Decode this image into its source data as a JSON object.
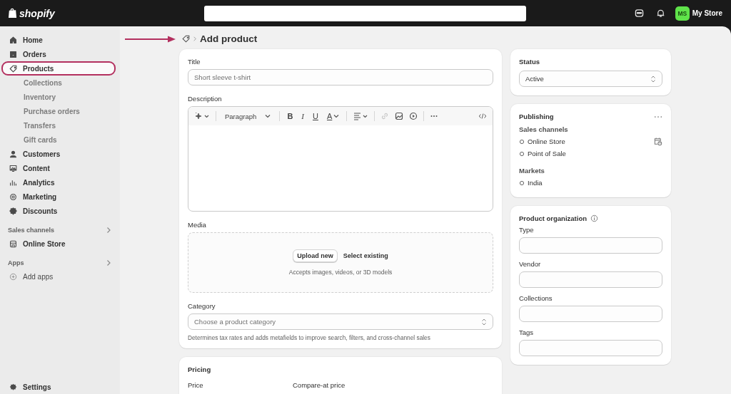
{
  "top_bar": {
    "logo": "shopify",
    "store": {
      "initials": "MS",
      "name": "My Store",
      "color": "#5fe34a"
    }
  },
  "annotations": {
    "arrow_to_title": true
  },
  "sidebar": {
    "items": [
      {
        "label": "Home",
        "selected": false,
        "outlined": false
      },
      {
        "label": "Orders",
        "selected": false,
        "outlined": false
      },
      {
        "label": "Products",
        "selected": true,
        "outlined": true,
        "children": [
          {
            "label": "Collections"
          },
          {
            "label": "Inventory"
          },
          {
            "label": "Purchase orders"
          },
          {
            "label": "Transfers"
          },
          {
            "label": "Gift cards"
          }
        ]
      },
      {
        "label": "Customers",
        "selected": false,
        "outlined": false
      },
      {
        "label": "Content",
        "selected": false,
        "outlined": false
      },
      {
        "label": "Analytics",
        "selected": false,
        "outlined": false
      },
      {
        "label": "Marketing",
        "selected": false,
        "outlined": false
      },
      {
        "label": "Discounts",
        "selected": false,
        "outlined": false
      }
    ],
    "sections": [
      {
        "title": "Sales channels",
        "items": [
          {
            "label": "Online Store",
            "kind": "store"
          }
        ]
      },
      {
        "title": "Apps",
        "items": [
          {
            "label": "Add apps",
            "kind": "add"
          }
        ]
      }
    ],
    "settings": "Settings"
  },
  "breadcrumb": {
    "title": "Add product"
  },
  "product_card": {
    "title_field": {
      "label": "Title",
      "placeholder": "Short sleeve t-shirt"
    },
    "description": {
      "label": "Description",
      "block_format": "Paragraph",
      "format_buttons": [
        {
          "label": "B",
          "kind": "bold"
        },
        {
          "label": "I",
          "kind": "italic"
        },
        {
          "label": "U",
          "kind": "underline"
        },
        {
          "label": "A",
          "kind": "color"
        }
      ],
      "link_disabled": true
    },
    "media": {
      "label": "Media",
      "upload_button": "Upload new",
      "select_link": "Select existing",
      "hint": "Accepts images, videos, or 3D models"
    },
    "category": {
      "label": "Category",
      "placeholder": "Choose a product category",
      "help": "Determines tax rates and adds metafields to improve search, filters, and cross-channel sales"
    }
  },
  "pricing": {
    "title": "Pricing",
    "labels": [
      "Price",
      "Compare-at price"
    ]
  },
  "status": {
    "title": "Status",
    "value": "Active"
  },
  "publishing": {
    "title": "Publishing",
    "sales_channels_label": "Sales channels",
    "sales_channels": [
      "Online Store",
      "Point of Sale"
    ],
    "markets_label": "Markets",
    "markets": [
      "India"
    ]
  },
  "product_organization": {
    "title": "Product organization",
    "fields": [
      "Type",
      "Vendor",
      "Collections",
      "Tags"
    ]
  }
}
